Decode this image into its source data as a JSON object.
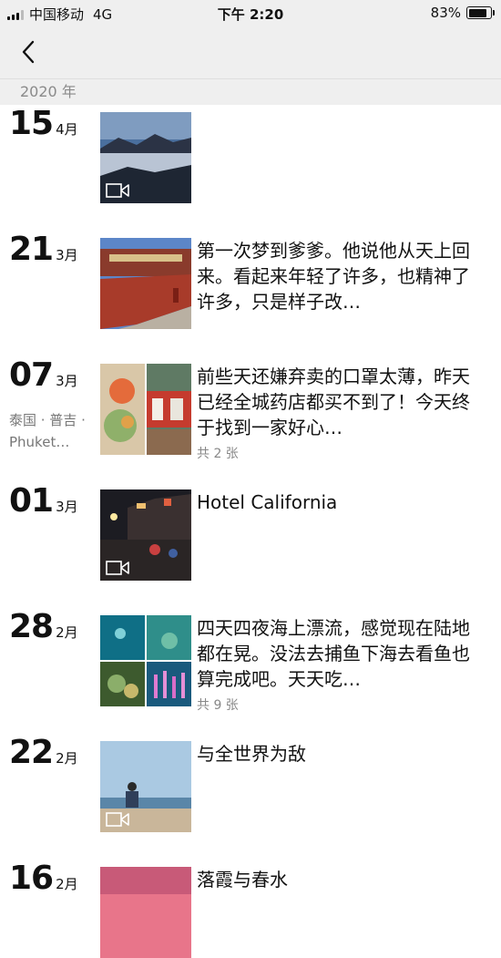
{
  "status": {
    "carrier": "中国移动",
    "network": "4G",
    "time": "下午 2:20",
    "battery": "83%",
    "battery_level": 0.83
  },
  "year": "2020 年",
  "entries": [
    {
      "day": "15",
      "month": "4月",
      "location": "",
      "text": "",
      "count": "",
      "video": true
    },
    {
      "day": "21",
      "month": "3月",
      "location": "",
      "text": "第一次梦到爹爹。他说他从天上回来。看起来年轻了许多，也精神了许多，只是样子改…",
      "count": "",
      "video": false
    },
    {
      "day": "07",
      "month": "3月",
      "location": "泰国 · 普吉 · Phuket…",
      "text": "前些天还嫌弃卖的口罩太薄，昨天已经全城药店都买不到了！今天终于找到一家好心…",
      "count": "共 2 张",
      "video": false
    },
    {
      "day": "01",
      "month": "3月",
      "location": "",
      "text": "Hotel California",
      "count": "",
      "video": true
    },
    {
      "day": "28",
      "month": "2月",
      "location": "",
      "text": "四天四夜海上漂流，感觉现在陆地都在晃。没法去捕鱼下海去看鱼也算完成吧。天天吃…",
      "count": "共 9 张",
      "video": false
    },
    {
      "day": "22",
      "month": "2月",
      "location": "",
      "text": "与全世界为敌",
      "count": "",
      "video": true
    },
    {
      "day": "16",
      "month": "2月",
      "location": "",
      "text": "落霞与春水",
      "count": "",
      "video": false
    }
  ]
}
